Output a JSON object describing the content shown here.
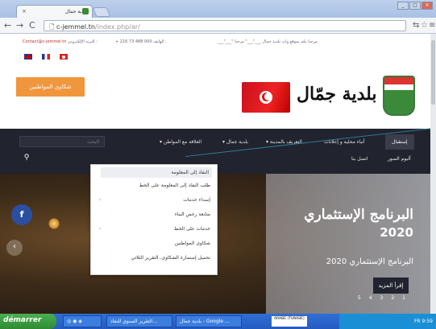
{
  "browser": {
    "tab_title": "بلدية جمال",
    "tab_close": "×",
    "url_host": "c-jemmel.tn",
    "url_path": "/index.php/ar/",
    "window_buttons": [
      "_",
      "□",
      "×"
    ]
  },
  "topinfo": {
    "email": "Contact@c-jemmel.tn",
    "email_label": "البريد الإلكتروني :",
    "phone": "+ 216 73 488 000",
    "phone_label": "الهاتف :",
    "welcome": "___\"___\" مرحبا بكم بموقع واب بلدية جمال ___\"___\" مرحبا"
  },
  "header": {
    "complaints_button": "شكاوى المواطنين",
    "site_title": "بلدية جمّال"
  },
  "nav": {
    "items": [
      {
        "label": "إستقبال"
      },
      {
        "label": "أنباء محلية و إعلانات"
      },
      {
        "label": "التعريف بالمدينة ▾"
      },
      {
        "label": "بلدية جمال ▾"
      },
      {
        "label": "العلاقة مع المواطن ▾"
      },
      {
        "label": "ألبوم الصور"
      },
      {
        "label": "اتصل بنا"
      }
    ],
    "search_placeholder": "البحث",
    "search_icon": "search-icon"
  },
  "dropdown": {
    "items": [
      {
        "label": "النفاذ إلى المعلومة"
      },
      {
        "label": "طلب النفاذ إلى المعلومة على الخط"
      },
      {
        "label": "إسداء خدمات"
      },
      {
        "label": "متابعة رخص البناء"
      },
      {
        "label": "خدمات على الخط"
      },
      {
        "label": "شكاوى المواطنين"
      },
      {
        "label": "تحميل إستمارة الشكاوى..التقرير الثلاثي"
      }
    ]
  },
  "hero": {
    "heading": "البرنامج الإستثماري",
    "year": "2020",
    "subheading": "البرنامج الإستثماري 2020",
    "read_more": "إقرأ المزيد",
    "pager": [
      "5",
      "4",
      "3",
      "2",
      "1"
    ],
    "fb_icon": "f",
    "arrow": "‹"
  },
  "taskbar": {
    "start": "démarrer",
    "tasks": [
      "التقرير السنوي للنفاذ...",
      "بلدية جمال - Google ..."
    ],
    "lang": "ARABE (TUNISIE)",
    "clock": "9:59",
    "lang_code": "FR"
  }
}
